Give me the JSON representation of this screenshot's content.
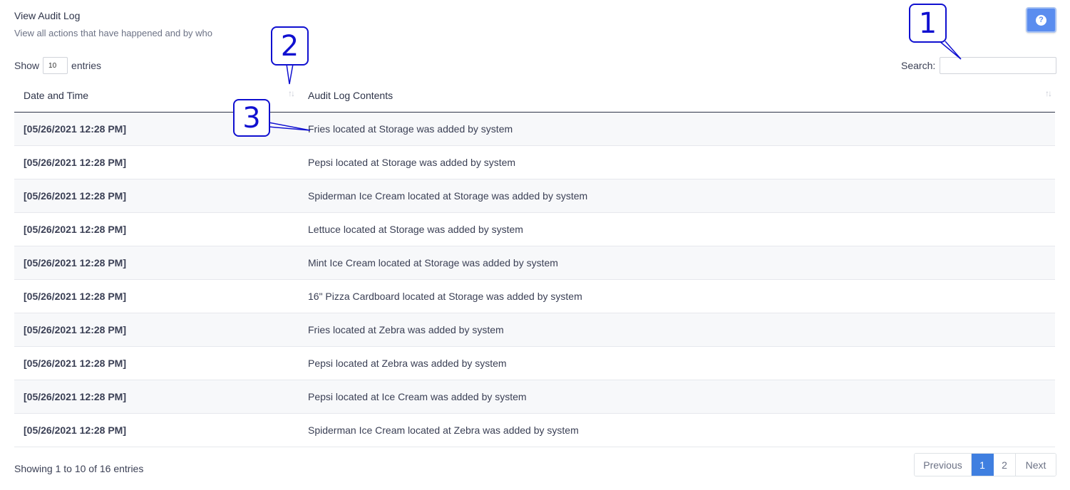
{
  "header": {
    "title": "View Audit Log",
    "subtitle": "View all actions that have happened and by who",
    "help_icon": "question-circle-icon",
    "help_glyph": "?"
  },
  "length": {
    "show_label": "Show",
    "value": "10",
    "entries_label": "entries"
  },
  "search": {
    "label": "Search:",
    "value": ""
  },
  "table": {
    "columns": [
      "Date and Time",
      "Audit Log Contents"
    ],
    "sort_glyph": "↑↓",
    "rows": [
      [
        "[05/26/2021 12:28 PM]",
        "Fries located at Storage was added by system"
      ],
      [
        "[05/26/2021 12:28 PM]",
        "Pepsi located at Storage was added by system"
      ],
      [
        "[05/26/2021 12:28 PM]",
        "Spiderman Ice Cream located at Storage was added by system"
      ],
      [
        "[05/26/2021 12:28 PM]",
        "Lettuce located at Storage was added by system"
      ],
      [
        "[05/26/2021 12:28 PM]",
        "Mint Ice Cream located at Storage was added by system"
      ],
      [
        "[05/26/2021 12:28 PM]",
        "16\" Pizza Cardboard located at Storage was added by system"
      ],
      [
        "[05/26/2021 12:28 PM]",
        "Fries located at Zebra was added by system"
      ],
      [
        "[05/26/2021 12:28 PM]",
        "Pepsi located at Zebra was added by system"
      ],
      [
        "[05/26/2021 12:28 PM]",
        "Pepsi located at Ice Cream was added by system"
      ],
      [
        "[05/26/2021 12:28 PM]",
        "Spiderman Ice Cream located at Zebra was added by system"
      ]
    ]
  },
  "footer": {
    "info": "Showing 1 to 10 of 16 entries"
  },
  "pagination": {
    "previous": "Previous",
    "pages": [
      "1",
      "2"
    ],
    "current": "1",
    "next": "Next"
  },
  "callouts": [
    "1",
    "2",
    "3"
  ],
  "colors": {
    "accent": "#3f7fe0",
    "callout": "#1010d0"
  }
}
